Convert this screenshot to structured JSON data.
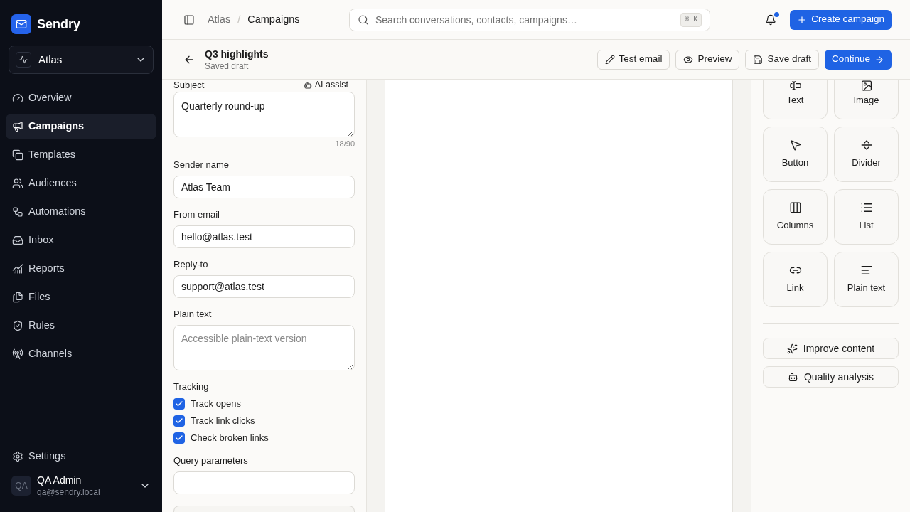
{
  "sidebar": {
    "brand": "Sendry",
    "workspace": "Atlas",
    "nav": [
      {
        "label": "Overview",
        "selected": false
      },
      {
        "label": "Campaigns",
        "selected": true
      },
      {
        "label": "Templates",
        "selected": false
      },
      {
        "label": "Audiences",
        "selected": false
      },
      {
        "label": "Automations",
        "selected": false
      },
      {
        "label": "Inbox",
        "selected": false
      },
      {
        "label": "Reports",
        "selected": false
      },
      {
        "label": "Files",
        "selected": false
      },
      {
        "label": "Rules",
        "selected": false
      },
      {
        "label": "Channels",
        "selected": false
      }
    ],
    "settings": "Settings",
    "user": {
      "initials": "QA",
      "name": "QA Admin",
      "email": "qa@sendry.local"
    }
  },
  "topbar": {
    "breadcrumbs": {
      "items": [
        "Atlas",
        "Campaigns"
      ],
      "separator": "/"
    },
    "search": {
      "placeholder": "Search conversations, contacts, campaigns…",
      "shortcut": "⌘ K"
    },
    "notifications": {
      "unread": true
    },
    "create_button": "Create campaign"
  },
  "header": {
    "title": "Q3 highlights",
    "status": "Saved draft",
    "actions": [
      {
        "label": "Test email",
        "kind": "outline"
      },
      {
        "label": "Preview",
        "kind": "outline"
      },
      {
        "label": "Save draft",
        "kind": "outline"
      },
      {
        "label": "Continue",
        "kind": "primary"
      }
    ]
  },
  "form": {
    "subject": {
      "label": "Subject",
      "assist": "AI assist",
      "value": "Quarterly round-up",
      "counter": "18/90"
    },
    "fields": [
      {
        "kind": "input",
        "label": "Sender name",
        "value": "Atlas Team"
      },
      {
        "kind": "input",
        "label": "From email",
        "value": "hello@atlas.test"
      },
      {
        "kind": "input",
        "label": "Reply-to",
        "value": "support@atlas.test"
      },
      {
        "kind": "textarea",
        "label": "Plain text",
        "placeholder": "Accessible plain-text version"
      }
    ],
    "tracking": {
      "label": "Tracking",
      "options": [
        {
          "label": "Track opens",
          "checked": true
        },
        {
          "label": "Track link clicks",
          "checked": true
        },
        {
          "label": "Check broken links",
          "checked": true
        }
      ]
    },
    "query": {
      "label": "Query parameters"
    }
  },
  "blocks": [
    {
      "label": "Text"
    },
    {
      "label": "Image"
    },
    {
      "label": "Button"
    },
    {
      "label": "Divider"
    },
    {
      "label": "Columns"
    },
    {
      "label": "List"
    },
    {
      "label": "Link"
    },
    {
      "label": "Plain text"
    }
  ],
  "tools": [
    "Improve content",
    "Quality analysis"
  ]
}
